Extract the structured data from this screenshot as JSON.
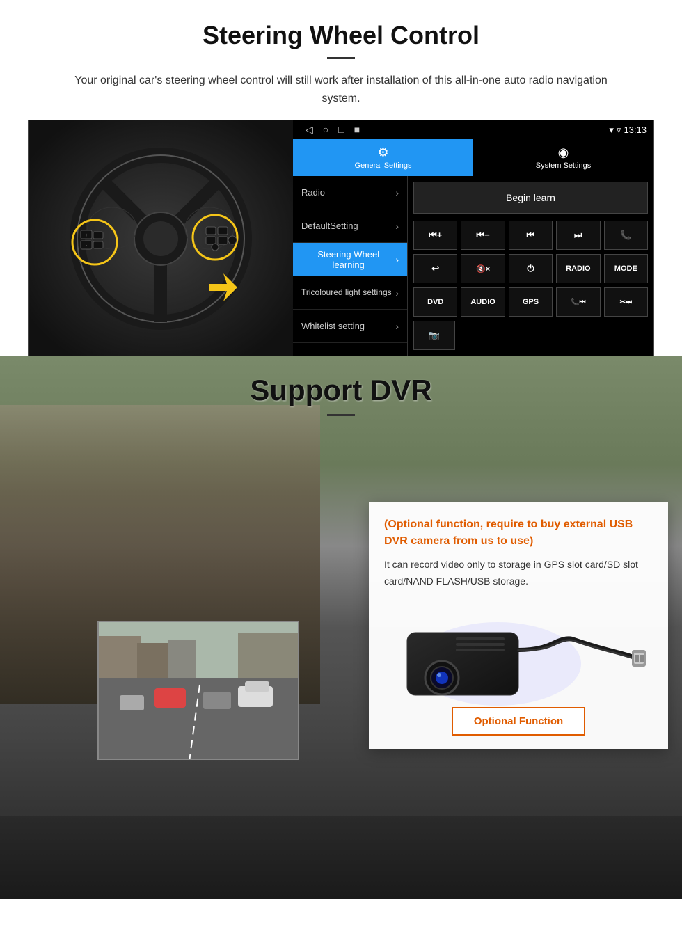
{
  "section1": {
    "title": "Steering Wheel Control",
    "subtitle": "Your original car's steering wheel control will still work after installation of this all-in-one auto radio navigation system.",
    "status_bar": {
      "time": "13:13",
      "icons": [
        "◁",
        "○",
        "□",
        "■"
      ]
    },
    "tabs": [
      {
        "label": "General Settings",
        "icon": "⚙",
        "active": true
      },
      {
        "label": "System Settings",
        "icon": "🌐",
        "active": false
      }
    ],
    "menu_items": [
      {
        "label": "Radio",
        "active": false
      },
      {
        "label": "DefaultSetting",
        "active": false
      },
      {
        "label": "Steering Wheel learning",
        "active": true
      },
      {
        "label": "Tricoloured light settings",
        "active": false
      },
      {
        "label": "Whitelist setting",
        "active": false
      }
    ],
    "begin_learn": "Begin learn",
    "control_buttons": [
      [
        "⏮+",
        "⏮-",
        "⏮⏮",
        "⏭⏭",
        "📞"
      ],
      [
        "↩",
        "🔇x",
        "⏻",
        "RADIO",
        "MODE"
      ],
      [
        "DVD",
        "AUDIO",
        "GPS",
        "📞⏮",
        "✂⏭⏭"
      ],
      [
        "📷"
      ]
    ]
  },
  "section2": {
    "title": "Support DVR",
    "optional_text": "(Optional function, require to buy external USB DVR camera from us to use)",
    "description": "It can record video only to storage in GPS slot card/SD slot card/NAND FLASH/USB storage.",
    "optional_function_label": "Optional Function"
  }
}
